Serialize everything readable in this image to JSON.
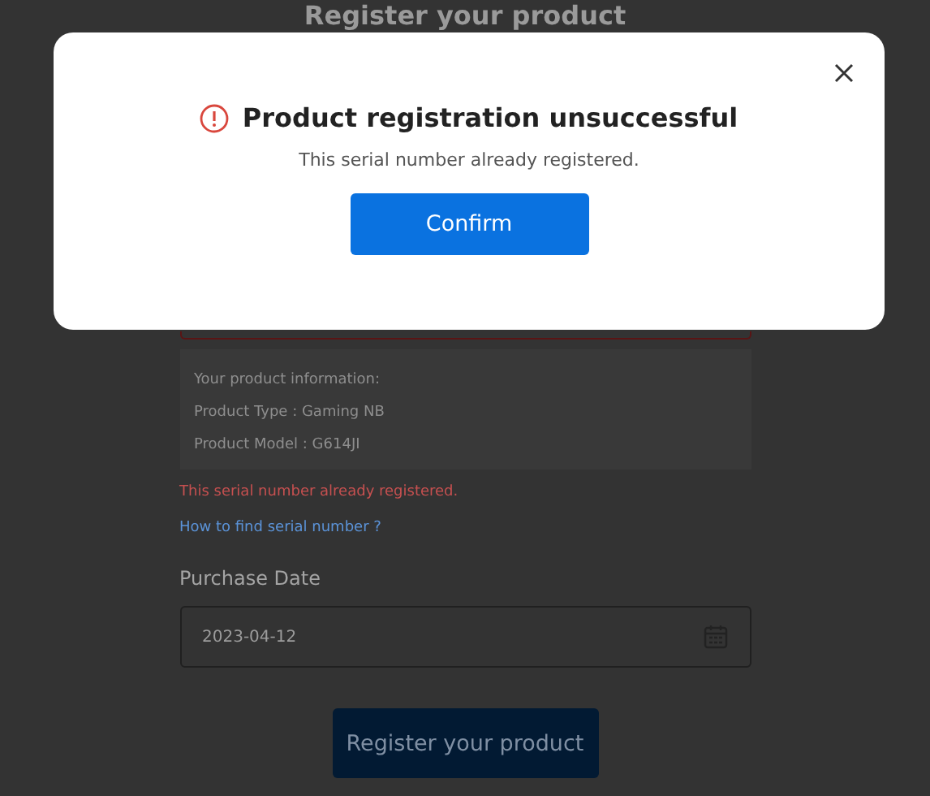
{
  "page": {
    "title": "Register your product",
    "product_info": [
      "Your product information:",
      "Product Type : Gaming NB",
      "Product Model : G614JI"
    ],
    "serial_error": "This serial number already registered.",
    "help_link": "How to find serial number ?",
    "purchase_date": {
      "label": "Purchase Date",
      "value": "2023-04-12"
    },
    "submit_button": "Register your product"
  },
  "dialog": {
    "title": "Product registration unsuccessful",
    "message": "This serial number already registered.",
    "buttons": [
      "Confirm"
    ]
  }
}
